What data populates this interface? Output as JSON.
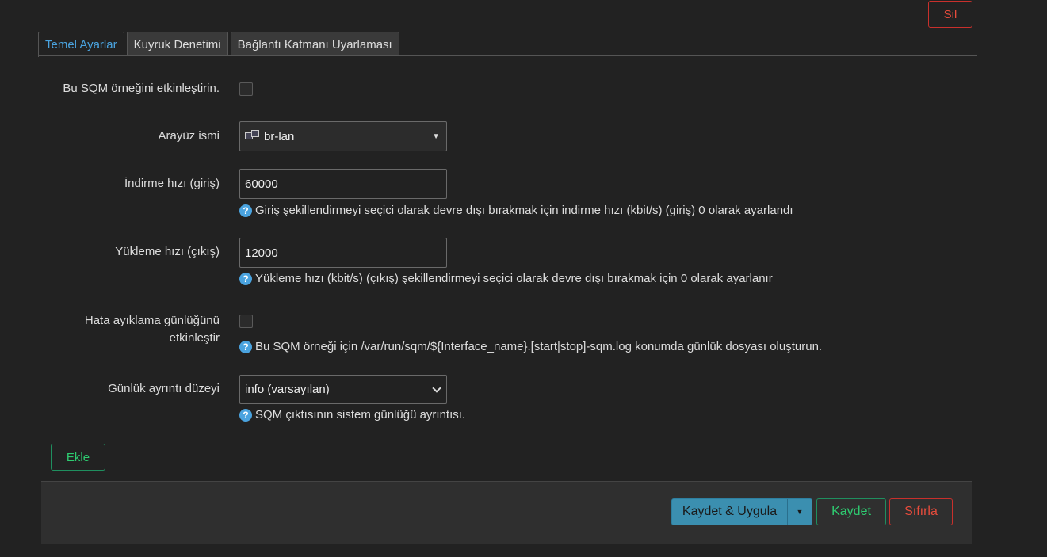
{
  "header": {
    "delete_label": "Sil"
  },
  "tabs": [
    {
      "label": "Temel Ayarlar",
      "active": true
    },
    {
      "label": "Kuyruk Denetimi",
      "active": false
    },
    {
      "label": "Bağlantı Katmanı Uyarlaması",
      "active": false
    }
  ],
  "form": {
    "enable": {
      "label": "Bu SQM örneğini etkinleştirin.",
      "checked": false
    },
    "interface": {
      "label": "Arayüz ismi",
      "value": "br-lan",
      "icon": "network-interface-icon"
    },
    "download": {
      "label": "İndirme hızı (giriş)",
      "value": "60000",
      "help": "Giriş şekillendirmeyi seçici olarak devre dışı bırakmak için indirme hızı (kbit/s) (giriş) 0 olarak ayarlandı"
    },
    "upload": {
      "label": "Yükleme hızı (çıkış)",
      "value": "12000",
      "help": "Yükleme hızı (kbit/s) (çıkış) şekillendirmeyi seçici olarak devre dışı bırakmak için 0 olarak ayarlanır"
    },
    "debug": {
      "label_line1": "Hata ayıklama günlüğünü",
      "label_line2": "etkinleştir",
      "checked": false,
      "help": "Bu SQM örneği için /var/run/sqm/${Interface_name}.[start|stop]-sqm.log konumda günlük dosyası oluşturun."
    },
    "verbosity": {
      "label": "Günlük ayrıntı düzeyi",
      "value": "info (varsayılan)",
      "help": "SQM çıktısının sistem günlüğü ayrıntısı."
    },
    "help_glyph": "?"
  },
  "add_label": "Ekle",
  "footer": {
    "save_apply_label": "Kaydet & Uygula",
    "save_label": "Kaydet",
    "reset_label": "Sıfırla"
  },
  "colors": {
    "accent": "#4aa3df",
    "danger": "#e74c3c",
    "success": "#2ecc71",
    "primary_button": "#3b8fb0"
  }
}
